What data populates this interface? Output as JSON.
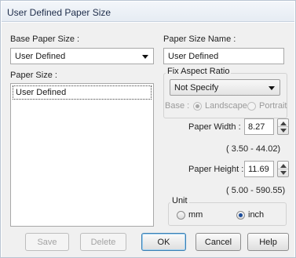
{
  "dialog": {
    "title": "User Defined Paper Size"
  },
  "base_paper_size": {
    "label": "Base Paper Size :",
    "selected": "User Defined"
  },
  "paper_size_name": {
    "label": "Paper Size Name :",
    "value": "User Defined"
  },
  "paper_size_list": {
    "label": "Paper Size :",
    "items": [
      "User Defined"
    ]
  },
  "fix_aspect_ratio": {
    "group_label": "Fix Aspect Ratio",
    "selected": "Not Specify",
    "base_label": "Base :",
    "options": [
      {
        "label": "Landscape",
        "selected": true,
        "enabled": false
      },
      {
        "label": "Portrait",
        "selected": false,
        "enabled": false
      }
    ]
  },
  "paper_width": {
    "label": "Paper Width :",
    "value": "8.27",
    "range": "( 3.50 - 44.02)"
  },
  "paper_height": {
    "label": "Paper Height :",
    "value": "11.69",
    "range": "( 5.00 - 590.55)"
  },
  "unit": {
    "group_label": "Unit",
    "options": [
      {
        "label": "mm",
        "selected": false
      },
      {
        "label": "inch",
        "selected": true
      }
    ]
  },
  "buttons": {
    "save": {
      "label": "Save",
      "enabled": false
    },
    "delete": {
      "label": "Delete",
      "enabled": false
    },
    "ok": {
      "label": "OK"
    },
    "cancel": {
      "label": "Cancel"
    },
    "help": {
      "label": "Help"
    }
  }
}
